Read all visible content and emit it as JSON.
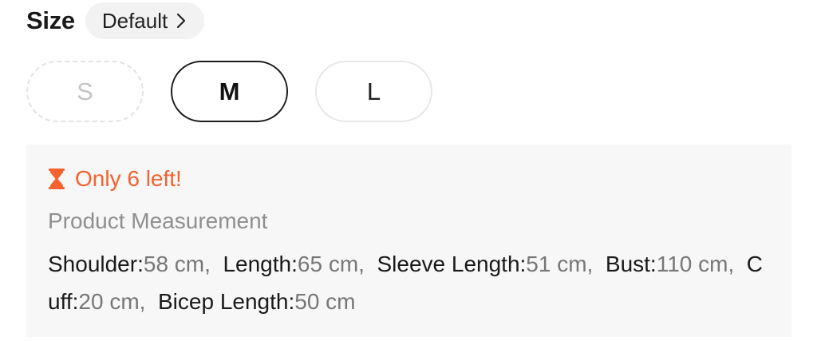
{
  "header": {
    "title": "Size",
    "size_system": "Default"
  },
  "sizes": [
    {
      "label": "S",
      "state": "unavailable"
    },
    {
      "label": "M",
      "state": "selected"
    },
    {
      "label": "L",
      "state": "available"
    }
  ],
  "stock": {
    "text": "Only 6 left!",
    "icon": "hourglass-icon",
    "color": "#f4622f"
  },
  "measurement": {
    "title": "Product Measurement",
    "items": [
      {
        "label": "Shoulder:",
        "value": "58 cm"
      },
      {
        "label": "Length:",
        "value": "65 cm"
      },
      {
        "label": "Sleeve Length:",
        "value": "51 cm"
      },
      {
        "label": "Bust:",
        "value": "110 cm"
      },
      {
        "label": "Cuff:",
        "value": "20 cm"
      },
      {
        "label": "Bicep Length:",
        "value": "50 cm"
      }
    ],
    "separator": ",  "
  }
}
